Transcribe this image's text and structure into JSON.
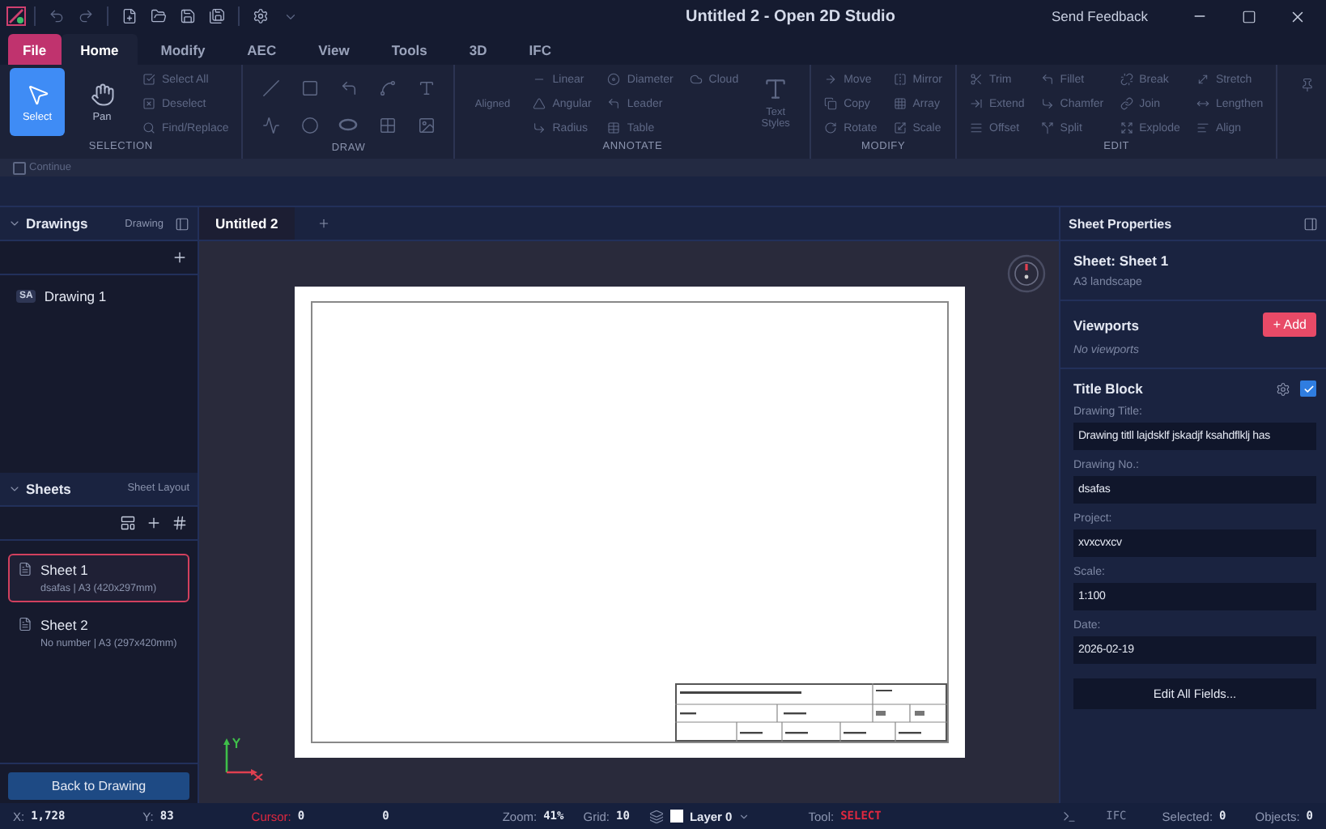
{
  "window": {
    "title": "Untitled 2 - Open 2D Studio",
    "feedback": "Send Feedback"
  },
  "menu_tabs": [
    {
      "label": "File",
      "kind": "file",
      "selected": false
    },
    {
      "label": "Home",
      "kind": "tab",
      "selected": true
    },
    {
      "label": "Modify",
      "kind": "tab",
      "selected": false
    },
    {
      "label": "AEC",
      "kind": "tab",
      "selected": false
    },
    {
      "label": "View",
      "kind": "tab",
      "selected": false
    },
    {
      "label": "Tools",
      "kind": "tab",
      "selected": false
    },
    {
      "label": "3D",
      "kind": "tab",
      "selected": false
    },
    {
      "label": "IFC",
      "kind": "tab",
      "selected": false
    }
  ],
  "ribbon": [
    {
      "title": "SELECTION",
      "large": [
        {
          "label": "Select",
          "selected": true,
          "disabled": false
        },
        {
          "label": "Pan",
          "selected": false,
          "disabled": false
        }
      ],
      "small": [
        {
          "label": "Select All",
          "disabled": true
        },
        {
          "label": "Deselect",
          "disabled": true
        },
        {
          "label": "Find/Replace",
          "disabled": true
        }
      ]
    },
    {
      "title": "DRAW"
    },
    {
      "title": "ANNOTATE",
      "large": [
        {
          "label": "Aligned",
          "selected": false,
          "disabled": true
        }
      ],
      "small": [
        {
          "label": "Linear",
          "disabled": true
        },
        {
          "label": "Angular",
          "disabled": true
        },
        {
          "label": "Radius",
          "disabled": true
        },
        {
          "label": "Diameter",
          "disabled": true
        },
        {
          "label": "Leader",
          "disabled": true
        },
        {
          "label": "Table",
          "disabled": true
        },
        {
          "label": "Cloud",
          "disabled": true
        }
      ],
      "large_after": [
        {
          "label": "Text Styles",
          "selected": false,
          "disabled": true
        }
      ]
    },
    {
      "title": "MODIFY",
      "small": [
        {
          "label": "Move",
          "disabled": true
        },
        {
          "label": "Copy",
          "disabled": true
        },
        {
          "label": "Rotate",
          "disabled": true
        },
        {
          "label": "Mirror",
          "disabled": true
        },
        {
          "label": "Array",
          "disabled": true
        },
        {
          "label": "Scale",
          "disabled": true
        }
      ]
    },
    {
      "title": "EDIT",
      "small": [
        {
          "label": "Trim",
          "disabled": true
        },
        {
          "label": "Extend",
          "disabled": true
        },
        {
          "label": "Offset",
          "disabled": true
        },
        {
          "label": "Fillet",
          "disabled": true
        },
        {
          "label": "Chamfer",
          "disabled": true
        },
        {
          "label": "Split",
          "disabled": true
        },
        {
          "label": "Break",
          "disabled": true
        },
        {
          "label": "Join",
          "disabled": true
        },
        {
          "label": "Explode",
          "disabled": true
        },
        {
          "label": "Stretch",
          "disabled": true
        },
        {
          "label": "Lengthen",
          "disabled": true
        },
        {
          "label": "Align",
          "disabled": true
        }
      ]
    }
  ],
  "continue": {
    "label": "Continue",
    "checked": false
  },
  "drawings": {
    "title": "Drawings",
    "mode": "Drawing",
    "expanded": true,
    "items": [
      {
        "badge": "SA",
        "name": "Drawing 1"
      }
    ]
  },
  "sheets": {
    "title": "Sheets",
    "mode": "Sheet Layout",
    "expanded": true,
    "items": [
      {
        "name": "Sheet 1",
        "detail": "dsafas | A3 (420x297mm)",
        "selected": true
      },
      {
        "name": "Sheet 2",
        "detail": "No number | A3 (297x420mm)",
        "selected": false
      }
    ],
    "back_button": "Back to Drawing"
  },
  "doc_tabs": [
    {
      "label": "Untitled 2",
      "selected": true
    }
  ],
  "properties": {
    "title": "Sheet Properties",
    "sheet_name": "Sheet: Sheet 1",
    "sheet_format": "A3 landscape",
    "viewports_title": "Viewports",
    "add_button": "+ Add",
    "viewports_empty": "No viewports",
    "title_block": "Title Block",
    "title_block_enabled": true,
    "fields": [
      {
        "label": "Drawing Title:",
        "value": "Drawing titll lajdsklf jskadjf ksahdflklj has"
      },
      {
        "label": "Drawing No.:",
        "value": "dsafas"
      },
      {
        "label": "Project:",
        "value": "xvxcvxcv"
      },
      {
        "label": "Scale:",
        "value": "1:100"
      },
      {
        "label": "Date:",
        "value": "2026-02-19"
      }
    ],
    "edit_button": "Edit All Fields..."
  },
  "status_bar": [
    {
      "kind": "reading",
      "label": "X:",
      "value": "1,728",
      "label_alert": false,
      "value_alert": false
    },
    {
      "kind": "reading",
      "label": "Y:",
      "value": "83",
      "label_alert": false,
      "value_alert": false
    },
    {
      "kind": "reading",
      "label": "Cursor:",
      "value": "0",
      "label_alert": true,
      "value_alert": false
    },
    {
      "kind": "reading",
      "value": "0",
      "value_alert": false
    },
    {
      "kind": "reading",
      "label": "Zoom:",
      "value": "41%",
      "label_alert": false,
      "value_alert": false
    },
    {
      "kind": "reading",
      "label": "Grid:",
      "value": "10",
      "label_alert": false,
      "value_alert": false
    },
    {
      "kind": "layer",
      "value": "Layer 0"
    },
    {
      "kind": "reading",
      "label": "Tool:",
      "value": "SELECT",
      "label_alert": false,
      "value_alert": true
    },
    {
      "kind": "terminal"
    },
    {
      "kind": "toggle",
      "value": "IFC",
      "disabled": true
    },
    {
      "kind": "reading",
      "label": "Selected:",
      "value": "0",
      "label_alert": false,
      "value_alert": false
    },
    {
      "kind": "reading",
      "label": "Objects:",
      "value": "0",
      "label_alert": false,
      "value_alert": false
    }
  ]
}
